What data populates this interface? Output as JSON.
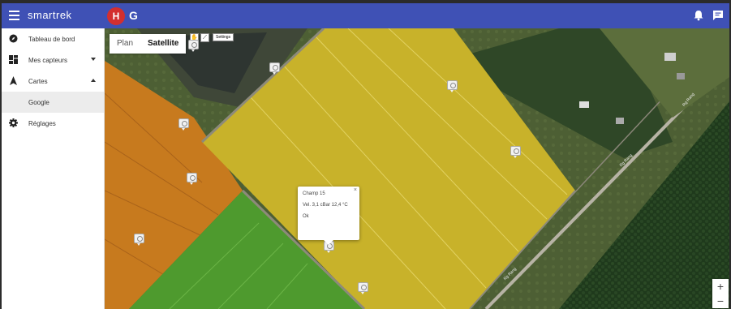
{
  "app": {
    "brand": "smartrek",
    "avatar_letter": "H",
    "g_letter": "G"
  },
  "sidebar": {
    "items": [
      {
        "label": "Tableau de bord",
        "icon": "compass-icon"
      },
      {
        "label": "Mes capteurs",
        "icon": "dashboard-icon"
      },
      {
        "label": "Cartes",
        "icon": "navigation-icon"
      },
      {
        "label": "Google",
        "icon": ""
      },
      {
        "label": "Réglages",
        "icon": "gear-icon"
      }
    ]
  },
  "map": {
    "type_plan": "Plan",
    "type_satellite": "Satellite",
    "settings_label": "Settings",
    "popup": {
      "title": "Champ 15",
      "reading": "Vel. 3,1 cBar 12,4 °C",
      "status": "Ok",
      "close": "×"
    },
    "zoom_in": "+",
    "zoom_out": "−",
    "road_label_1": "Rg Rang",
    "road_label_2": "Rg Rang",
    "road_label_3": "Rg Rang"
  },
  "colors": {
    "topbar": "#3f51b5",
    "avatar": "#d32f2f",
    "field_yellow": "#c8b22a",
    "field_orange": "#c77a1e",
    "field_green": "#4e9a2e"
  }
}
